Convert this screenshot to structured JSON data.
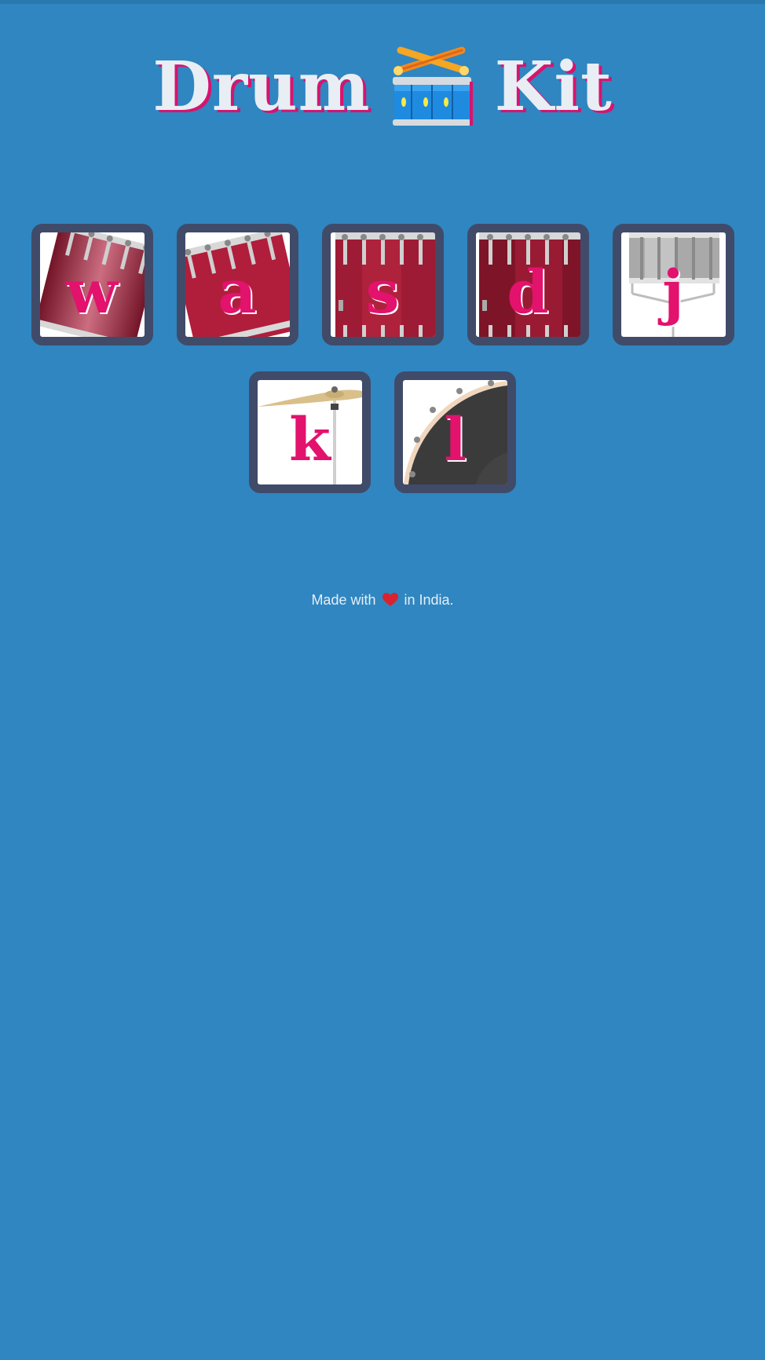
{
  "header": {
    "title_left": "Drum",
    "title_right": "Kit",
    "title_icon": "drum-icon"
  },
  "keys": [
    {
      "letter": "w",
      "instrument": "tom-1-icon"
    },
    {
      "letter": "a",
      "instrument": "tom-2-icon"
    },
    {
      "letter": "s",
      "instrument": "tom-3-icon"
    },
    {
      "letter": "d",
      "instrument": "tom-4-icon"
    },
    {
      "letter": "j",
      "instrument": "snare-icon"
    },
    {
      "letter": "k",
      "instrument": "crash-cymbal-icon"
    },
    {
      "letter": "l",
      "instrument": "kick-drum-icon"
    }
  ],
  "footer": {
    "prefix": "Made with",
    "suffix": "in India.",
    "icon": "heart-icon"
  },
  "colors": {
    "background": "#2f86c1",
    "key_border": "#404b69",
    "letter": "#e2126d",
    "title_text": "#e8eef4",
    "title_shadow": "#d6146f"
  }
}
